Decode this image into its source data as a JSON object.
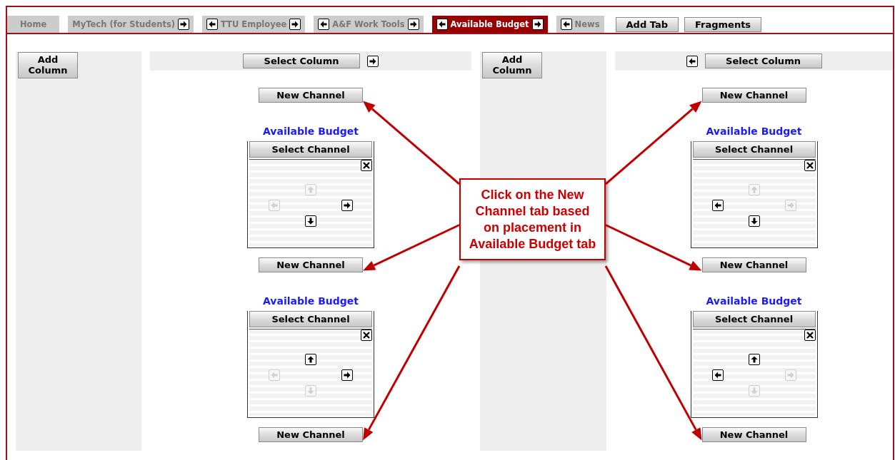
{
  "tabs": [
    {
      "label": "Home",
      "selected": false,
      "move_left": false,
      "move_right": false
    },
    {
      "label": "MyTech (for Students)",
      "selected": false,
      "move_left": false,
      "move_right": true
    },
    {
      "label": "TTU Employee",
      "selected": false,
      "move_left": true,
      "move_right": true
    },
    {
      "label": "A&F Work Tools",
      "selected": false,
      "move_left": true,
      "move_right": true
    },
    {
      "label": "Available Budget",
      "selected": true,
      "move_left": true,
      "move_right": true
    },
    {
      "label": "News",
      "selected": false,
      "move_left": true,
      "move_right": false
    }
  ],
  "tab_buttons": [
    "Add Tab",
    "Fragments"
  ],
  "columns": [
    {
      "add_column": "Add Column",
      "select_column": "Select Column",
      "move_left": false,
      "move_right": true,
      "items": [
        {
          "kind": "new_channel",
          "label": "New Channel"
        },
        {
          "kind": "channel",
          "title": "Available Budget",
          "select_channel": "Select Channel",
          "up_enabled": false,
          "left_enabled": false,
          "right_enabled": true,
          "down_enabled": true
        },
        {
          "kind": "new_channel",
          "label": "New Channel"
        },
        {
          "kind": "channel",
          "title": "Available Budget",
          "select_channel": "Select Channel",
          "up_enabled": true,
          "left_enabled": false,
          "right_enabled": true,
          "down_enabled": false
        },
        {
          "kind": "new_channel",
          "label": "New Channel"
        }
      ]
    },
    {
      "add_column": "Add Column",
      "select_column": "Select Column",
      "move_left": true,
      "move_right": false,
      "items": [
        {
          "kind": "new_channel",
          "label": "New Channel"
        },
        {
          "kind": "channel",
          "title": "Available Budget",
          "select_channel": "Select Channel",
          "up_enabled": false,
          "left_enabled": true,
          "right_enabled": false,
          "down_enabled": true
        },
        {
          "kind": "new_channel",
          "label": "New Channel"
        },
        {
          "kind": "channel",
          "title": "Available Budget",
          "select_channel": "Select Channel",
          "up_enabled": true,
          "left_enabled": true,
          "right_enabled": false,
          "down_enabled": false
        },
        {
          "kind": "new_channel",
          "label": "New Channel"
        }
      ]
    }
  ],
  "callout": {
    "text": "Click on the New Channel tab based on placement in Available Budget tab"
  }
}
